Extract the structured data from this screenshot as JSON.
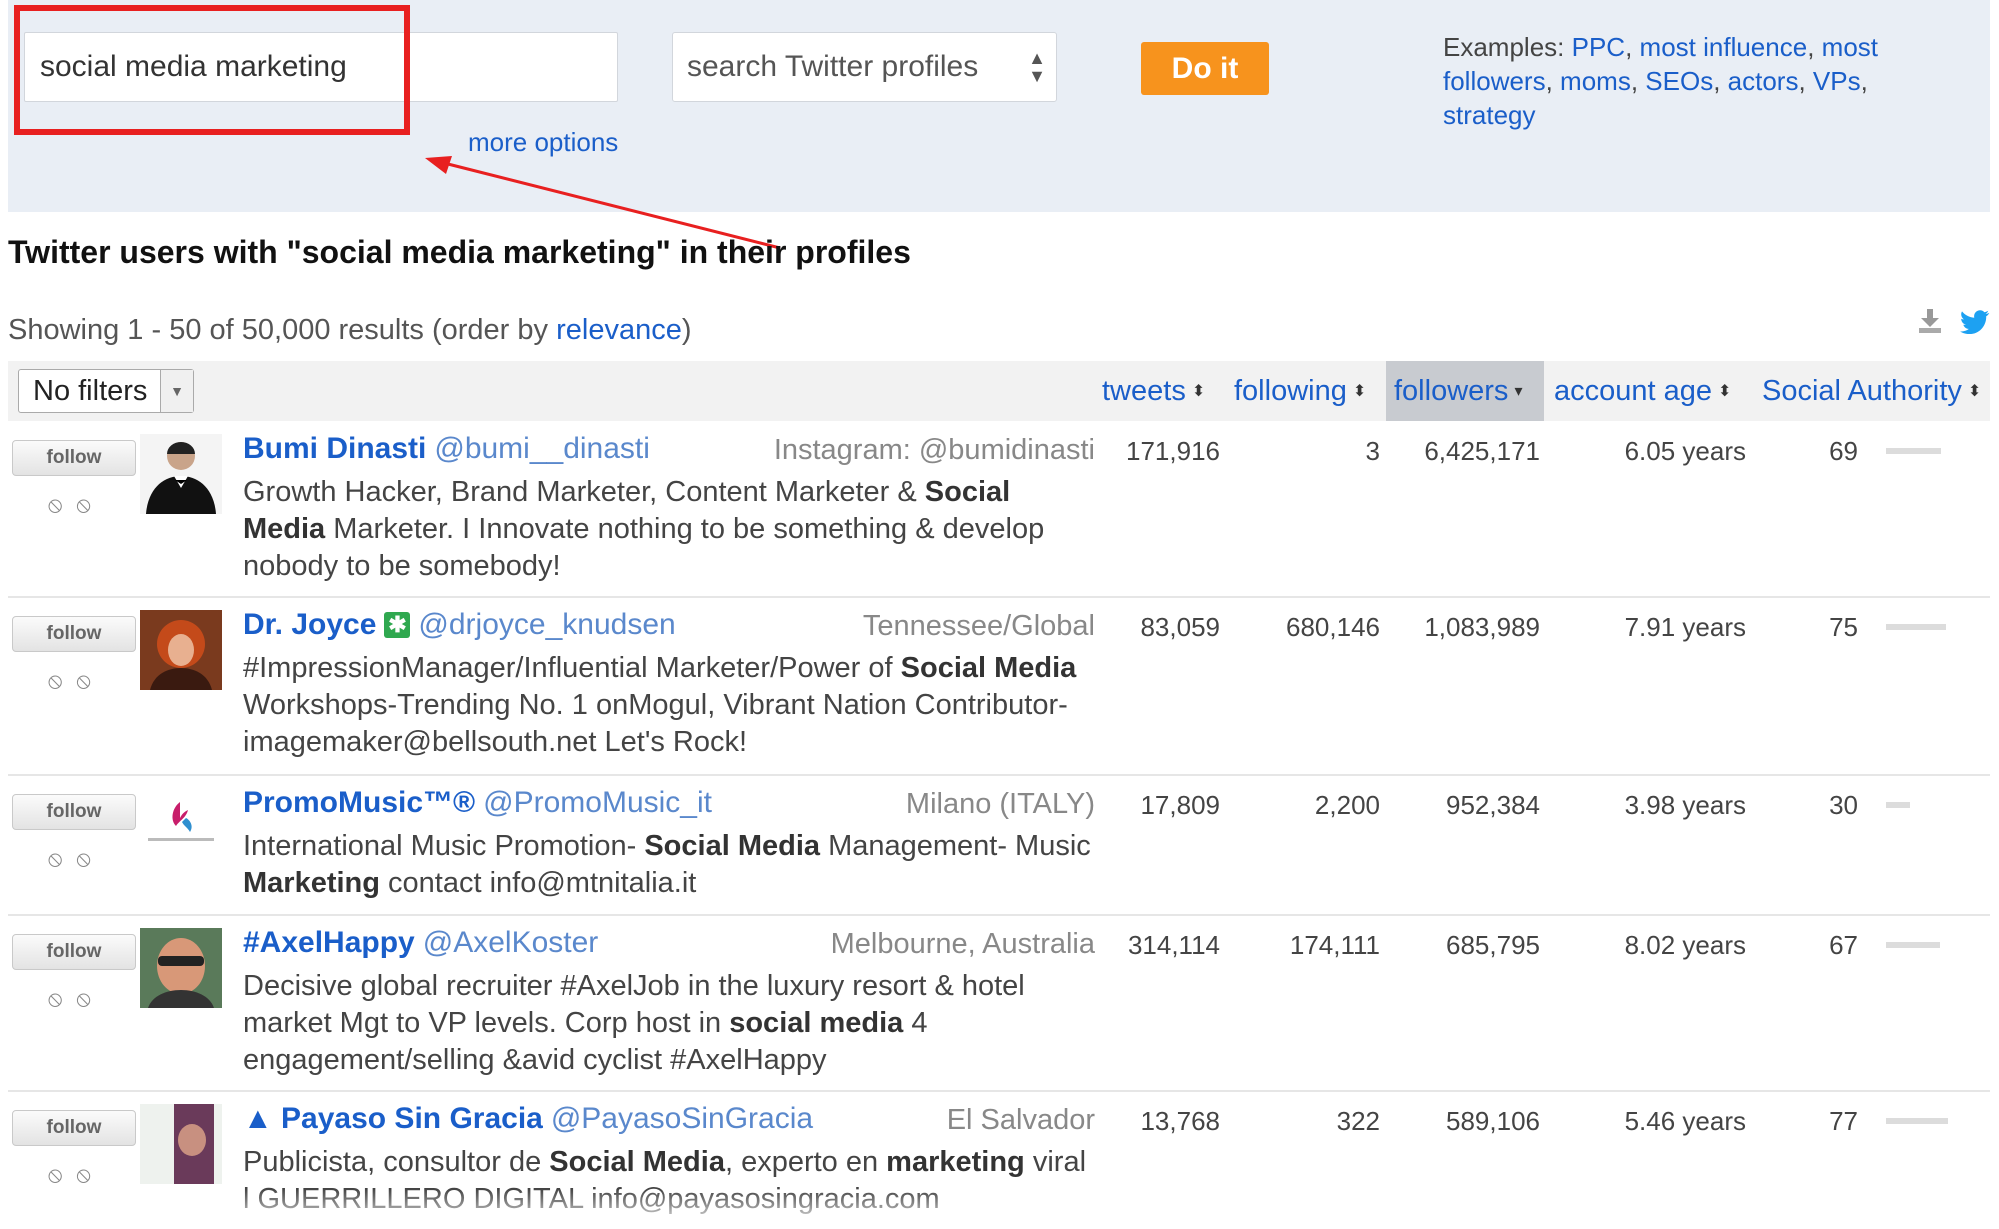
{
  "search": {
    "query": "social media marketing",
    "type_label": "search Twitter profiles",
    "submit_label": "Do it",
    "more_options_label": "more options",
    "examples_label": "Examples:",
    "examples": [
      "PPC",
      "most influence",
      "most followers",
      "moms",
      "SEOs",
      "actors",
      "VPs",
      "strategy"
    ]
  },
  "results": {
    "title": "Twitter users with \"social media marketing\" in their profiles",
    "showing_prefix": "Showing 1 - 50 of 50,000 results (order by ",
    "order_by": "relevance",
    "showing_suffix": ")",
    "filter_label": "No filters"
  },
  "columns": {
    "tweets": "tweets",
    "following": "following",
    "followers": "followers",
    "account_age": "account age",
    "social_authority": "Social Authority"
  },
  "follow_label": "follow",
  "rows": [
    {
      "name": "Bumi Dinasti",
      "handle": "@bumi__dinasti",
      "location": "Instagram: @bumidinasti",
      "bio": [
        "Growth Hacker, Brand Marketer, Content Marketer & ",
        "Social Media",
        " Marketer. I Innovate nothing to be something & develop nobody to be somebody!"
      ],
      "tweets": "171,916",
      "following": "3",
      "followers": "6,425,171",
      "age": "6.05 years",
      "sa": 69
    },
    {
      "name": "Dr. Joyce",
      "badge": "✱",
      "handle": "@drjoyce_knudsen",
      "location": "Tennessee/Global",
      "bio": [
        "#ImpressionManager/Influential Marketer/Power of ",
        "Social Media",
        " Workshops-Trending No. 1 onMogul, Vibrant Nation Contributor-imagemaker@bellsouth.net Let's Rock!"
      ],
      "tweets": "83,059",
      "following": "680,146",
      "followers": "1,083,989",
      "age": "7.91 years",
      "sa": 75
    },
    {
      "name": "PromoMusic™®",
      "handle": "@PromoMusic_it",
      "location": "Milano (ITALY)",
      "bio": [
        "International Music Promotion- ",
        "Social Media",
        " Management- Music ",
        "Marketing",
        " contact info@mtnitalia.it"
      ],
      "tweets": "17,809",
      "following": "2,200",
      "followers": "952,384",
      "age": "3.98 years",
      "sa": 30
    },
    {
      "name": "#AxelHappy",
      "handle": "@AxelKoster",
      "location": "Melbourne, Australia",
      "bio": [
        "Decisive global recruiter #AxelJob in the luxury resort & hotel market Mgt to VP levels. Corp host in ",
        "social media",
        " 4 engagement/selling &avid cyclist #AxelHappy"
      ],
      "tweets": "314,114",
      "following": "174,111",
      "followers": "685,795",
      "age": "8.02 years",
      "sa": 67
    },
    {
      "name": "▲ Payaso Sin Gracia",
      "handle": "@PayasoSinGracia",
      "location": "El Salvador",
      "bio": [
        "Publicista, consultor de ",
        "Social Media",
        ", experto en ",
        "marketing",
        " viral l GUERRILLERO DIGITAL info@payasosingracia.com"
      ],
      "tweets": "13,768",
      "following": "322",
      "followers": "589,106",
      "age": "5.46 years",
      "sa": 77
    }
  ],
  "colors": {
    "link": "#1a5ec9",
    "accent_button": "#f7931d",
    "highlight": "#e82020",
    "panel_bg": "#e9eef5"
  }
}
